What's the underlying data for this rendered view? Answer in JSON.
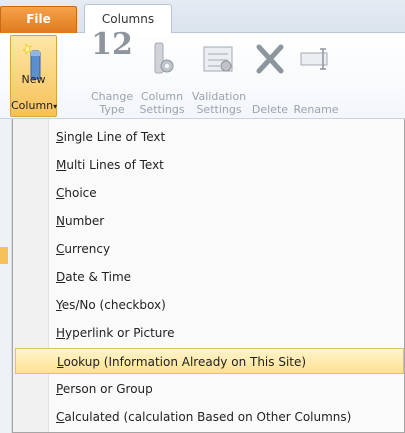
{
  "tabs": {
    "file": "File",
    "columns": "Columns"
  },
  "ribbon": {
    "new_column": {
      "line1": "New",
      "line2": "Column",
      "arrow": "▾"
    },
    "change_type": {
      "label": "Change\nType",
      "icon_text": "12"
    },
    "column_settings": {
      "label": "Column\nSettings"
    },
    "validation_settings": {
      "label": "Validation\nSettings"
    },
    "delete": {
      "label": "Delete"
    },
    "rename": {
      "label": "Rename"
    }
  },
  "menu": {
    "items": [
      {
        "key": "S",
        "rest": "ingle Line of Text"
      },
      {
        "key": "M",
        "rest": "ulti Lines of Text"
      },
      {
        "key": "C",
        "rest": "hoice"
      },
      {
        "key": "N",
        "rest": "umber"
      },
      {
        "key": "C",
        "rest": "urrency"
      },
      {
        "key": "D",
        "rest": "ate & Time"
      },
      {
        "key": "Y",
        "rest": "es/No (checkbox)"
      },
      {
        "key": "H",
        "rest": "yperlink or Picture"
      },
      {
        "key": "L",
        "rest": "ookup (Information Already on This Site)"
      },
      {
        "key": "P",
        "rest": "erson or Group"
      },
      {
        "key": "C",
        "rest": "alculated (calculation Based on Other Columns)"
      }
    ],
    "highlighted_index": 8
  },
  "colors": {
    "file_tab": "#e07a1c",
    "highlight": "#fde290",
    "disabled_text": "#9aa3ad"
  }
}
